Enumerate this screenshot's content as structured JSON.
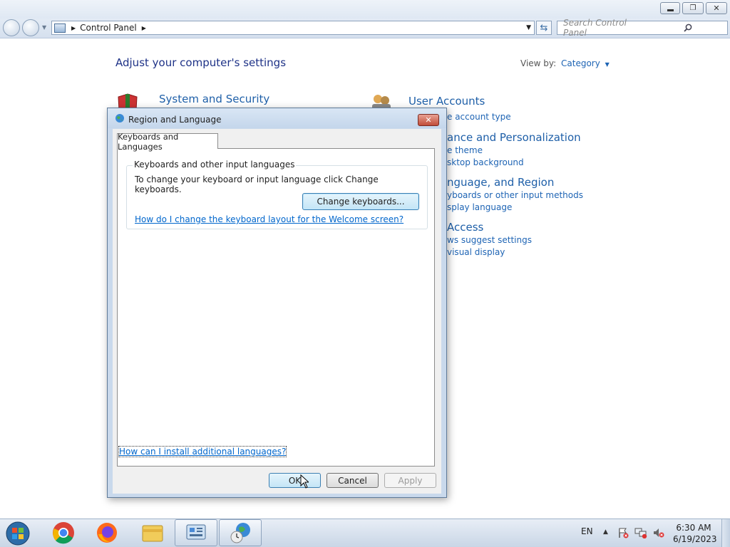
{
  "window": {
    "address": {
      "crumb": "Control Panel"
    },
    "search": {
      "placeholder": "Search Control Panel"
    }
  },
  "control_panel": {
    "heading": "Adjust your computer's settings",
    "view_by_label": "View by:",
    "view_by_value": "Category",
    "categories": [
      {
        "title": "System and Security",
        "links": []
      },
      {
        "title": "User Accounts",
        "links": [
          "e account type"
        ]
      },
      {
        "title": "ance and Personalization",
        "links": [
          "e theme",
          "sktop background"
        ]
      },
      {
        "title": "nguage, and Region",
        "links": [
          "yboards or other input methods",
          "splay language"
        ]
      },
      {
        "title": "Access",
        "links": [
          "ws suggest settings",
          "visual display"
        ]
      }
    ]
  },
  "dialog": {
    "title": "Region and Language",
    "tab": "Keyboards and Languages",
    "group_label": "Keyboards and other input languages",
    "instruction": "To change your keyboard or input language click Change keyboards.",
    "change_keyboards_button": "Change keyboards...",
    "welcome_link": "How do I change the keyboard layout for the Welcome screen?",
    "install_link": "How can I install additional languages?",
    "ok_button": "OK",
    "cancel_button": "Cancel",
    "apply_button": "Apply"
  },
  "taskbar": {
    "language": "EN",
    "time": "6:30 AM",
    "date": "6/19/2023"
  },
  "colors": {
    "accent": "#1e64b4",
    "link": "#0066cc",
    "close_red": "#c14d39"
  }
}
